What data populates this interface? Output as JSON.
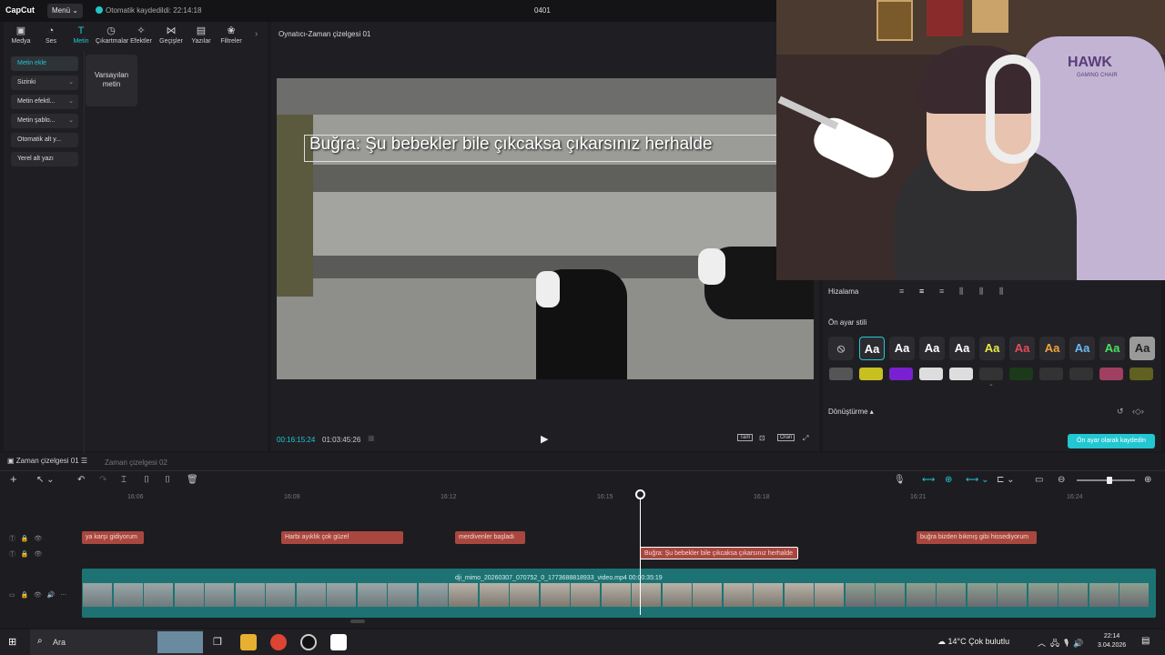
{
  "titlebar": {
    "logo": "CapCut",
    "menu": "Menü",
    "saved": "Otomatik kaydedildi: 22:14:18",
    "project": "0401"
  },
  "tools": [
    {
      "label": "Medya",
      "icon": "media-icon",
      "glyph": "▣"
    },
    {
      "label": "Ses",
      "icon": "audio-icon",
      "glyph": "◔"
    },
    {
      "label": "Metin",
      "icon": "text-icon",
      "glyph": "T"
    },
    {
      "label": "Çıkartmalar",
      "icon": "sticker-icon",
      "glyph": "◷"
    },
    {
      "label": "Efektler",
      "icon": "effects-icon",
      "glyph": "✧"
    },
    {
      "label": "Geçişler",
      "icon": "transitions-icon",
      "glyph": "⋈"
    },
    {
      "label": "Yazılar",
      "icon": "captions-icon",
      "glyph": "▤"
    },
    {
      "label": "Filtreler",
      "icon": "filters-icon",
      "glyph": "❀"
    }
  ],
  "left_menu": [
    {
      "label": "Metin ekle",
      "active": true,
      "chevron": ""
    },
    {
      "label": "Sizinki",
      "active": false,
      "chevron": "⌄"
    },
    {
      "label": "Metin efektl...",
      "active": false,
      "chevron": "⌄"
    },
    {
      "label": "Metin şablo...",
      "active": false,
      "chevron": "⌄"
    },
    {
      "label": "Otomatik alt y...",
      "active": false,
      "chevron": ""
    },
    {
      "label": "Yerel alt yazı",
      "active": false,
      "chevron": ""
    }
  ],
  "preset_card": "Varsayılan metin",
  "player": {
    "header": "Oynatıcı-Zaman çizelgesi 01",
    "subtitle": "Buğra: Şu bebekler bile çıkcaksa çıkarsınız herhalde",
    "current_time": "00:16:15:24",
    "duration": "01:03:45:26",
    "full_label": "Tam",
    "ratio_label": "Oran"
  },
  "right_panel": {
    "alignment_label": "Hizalama",
    "preset_style_label": "Ön ayar stili",
    "transform_label": "Dönüştürme",
    "save_preset": "Ön ayar olarak kaydedin",
    "style_sample": "Aa",
    "style_colors": [
      "#ffffff",
      "#ffffff",
      "#ffffff",
      "#ffffff",
      "#e8e84a",
      "#e84a5a",
      "#f0a040",
      "#6ab8f0",
      "#4ae060",
      "#222222"
    ]
  },
  "timeline": {
    "tab1": "Zaman çizelgesi 01",
    "tab2": "Zaman çizelgesi 02",
    "ticks": [
      "16:06",
      "16:09",
      "16:12",
      "16:15",
      "16:18",
      "16:21",
      "16:24"
    ],
    "text_clips_row1": [
      "ya karşı gidiyorum",
      "Harbi ayıklık çok güzel",
      "merdivenler başladı",
      "buğra bizden bıkmış gibi hissediyorum"
    ],
    "text_clip_selected": "Buğra: Şu bebekler bile çıkcaksa çıkarsınız herhalde",
    "video_clip": "dji_mimo_20260307_070752_0_1773688818933_video.mp4   00:00:35:19"
  },
  "taskbar": {
    "search": "Ara",
    "weather": "14°C  Çok bulutlu",
    "time": "22:14",
    "date": "3.04.2026"
  },
  "webcam": {
    "logo": "HAWK",
    "logo_sub": "GAMING CHAIR"
  },
  "colors": {
    "accent": "#22c7d2",
    "clip_red": "#a9473f",
    "video_teal": "#1d7373"
  }
}
